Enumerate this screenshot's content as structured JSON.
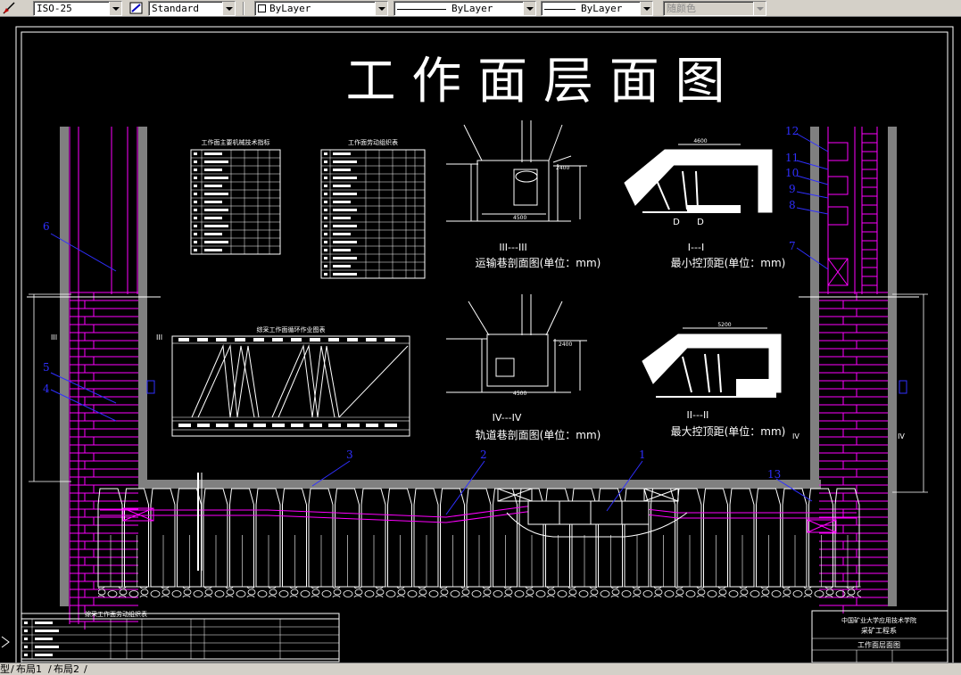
{
  "toolbar": {
    "dimstyle": "ISO-25",
    "textstyle": "Standard",
    "layer": "ByLayer",
    "linetype": "ByLayer",
    "lineweight": "ByLayer",
    "plotstyle": "随颜色"
  },
  "drawing": {
    "title": "工 作 面 层 面 图",
    "table1_title": "工作面主要机械技术指标",
    "table2_title": "工作面劳动组织表",
    "cycle_title": "综采工作面循环作业图表",
    "labor_title": "综采工作面劳动组织表",
    "sec3_id": "III---III",
    "sec3_caption": "运输巷剖面图(单位：mm)",
    "sec4_id": "IV---IV",
    "sec4_caption": "轨道巷剖面图(单位：mm)",
    "sec1_id": "I---I",
    "sec1_caption": "最小控顶距(单位：mm)",
    "sec2_id": "II---II",
    "sec2_caption": "最大控顶距(单位：mm)",
    "dim_4600": "4600",
    "dim_5200": "5200",
    "dim_4500": "4500",
    "dim_4500b": "4500",
    "dim_2400": "2400",
    "dim_2400b": "2400",
    "dim_d": "D",
    "dim_d2": "D",
    "mark_iii": "III",
    "mark_iii_r": "III",
    "mark_iv": "IV",
    "mark_iv_r": "IV",
    "callouts": [
      "1",
      "2",
      "3",
      "4",
      "5",
      "6",
      "7",
      "8",
      "9",
      "10",
      "11",
      "12",
      "13"
    ],
    "tb_school": "中国矿业大学应用技术学院",
    "tb_dept": "采矿工程系",
    "tb_title": "工作面层面图"
  },
  "tabs": {
    "model": "型",
    "layout1": "布局1",
    "layout2": "布局2"
  },
  "colors": {
    "background": "#000000",
    "linework": "#ffffff",
    "magenta": "#ff00ff",
    "callout": "#2f2fff",
    "coal_wall": "#808080"
  }
}
